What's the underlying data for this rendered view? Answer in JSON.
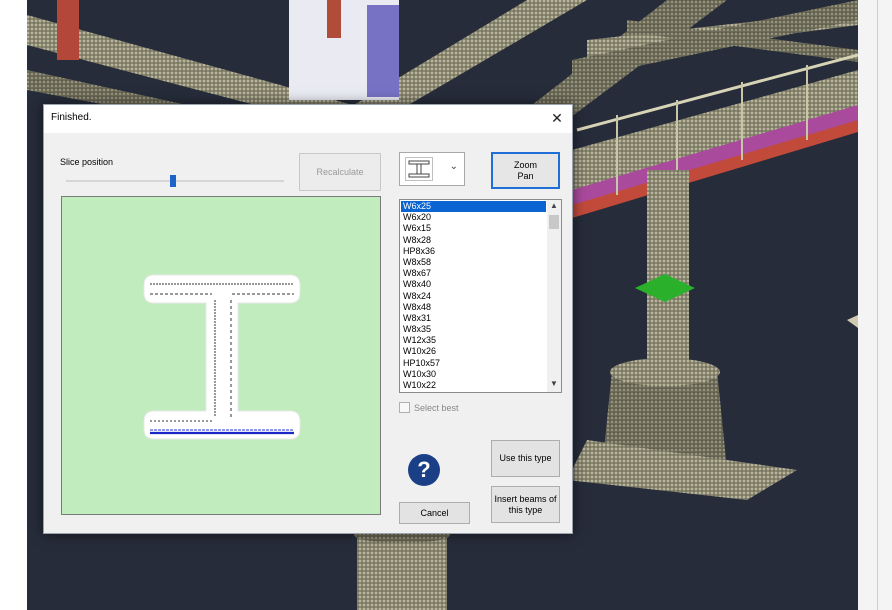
{
  "dialog": {
    "title": "Finished.",
    "close_glyph": "✕",
    "slice_position_label": "Slice position",
    "slice_position_value": 0.49,
    "recalculate_label": "Recalculate",
    "zoom_pan_line1": "Zoom",
    "zoom_pan_line2": "Pan",
    "section_type_icon": "i-beam-icon",
    "beam_types": [
      "W6x25",
      "W6x20",
      "W6x15",
      "W8x28",
      "HP8x36",
      "W8x58",
      "W8x67",
      "W8x40",
      "W8x24",
      "W8x48",
      "W8x31",
      "W8x35",
      "W12x35",
      "W10x26",
      "HP10x57",
      "W10x30",
      "W10x22"
    ],
    "selected_type": "W6x25",
    "select_best_label": "Select best",
    "select_best_checked": false,
    "help_glyph": "?",
    "use_type_label": "Use this type",
    "insert_beams_line1": "Insert beams of",
    "insert_beams_line2": "this type",
    "cancel_label": "Cancel"
  },
  "colors": {
    "accent": "#1f6fd6",
    "preview_bg": "#c0ecbe",
    "selection": "#0a64d2",
    "help": "#1a3f86"
  }
}
